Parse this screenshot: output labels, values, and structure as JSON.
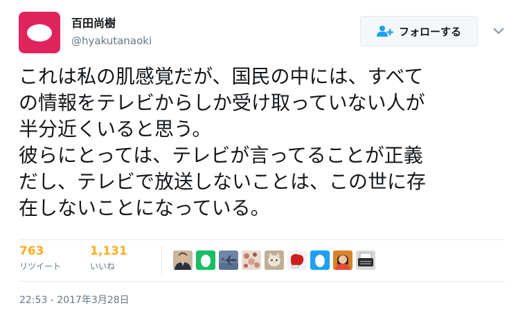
{
  "user": {
    "display_name": "百田尚樹",
    "handle": "@hyakutanaoki",
    "avatar_color": "#e0245e"
  },
  "follow_button": {
    "label": "フォローする",
    "icon": "add-user-icon",
    "icon_color": "#1da1f2"
  },
  "menu": {
    "icon": "chevron-down-icon"
  },
  "tweet": {
    "lines": [
      "これは私の肌感覚だが、国民の中には、すべて",
      "の情報をテレビからしか受け取っていない人が",
      "半分近くいると思う。",
      "彼らにとっては、テレビが言ってることが正義",
      "だし、テレビで放送しないことは、この世に存",
      "在しないことになっている。"
    ]
  },
  "stats": {
    "retweets": {
      "count": "763",
      "label": "リツイート"
    },
    "likes": {
      "count": "1,131",
      "label": "いいね"
    },
    "count_color": "#ffad1f"
  },
  "liked_by": [
    {
      "icon": "man-portrait-avatar"
    },
    {
      "icon": "green-egg-avatar"
    },
    {
      "icon": "jet-aircraft-avatar"
    },
    {
      "icon": "cartoon-pattern-avatar"
    },
    {
      "icon": "cat-avatar"
    },
    {
      "icon": "boxing-glove-avatar"
    },
    {
      "icon": "blue-egg-avatar"
    },
    {
      "icon": "woman-portrait-avatar"
    },
    {
      "icon": "typewriter-avatar"
    }
  ],
  "timestamp": "22:53 - 2017年3月28日"
}
